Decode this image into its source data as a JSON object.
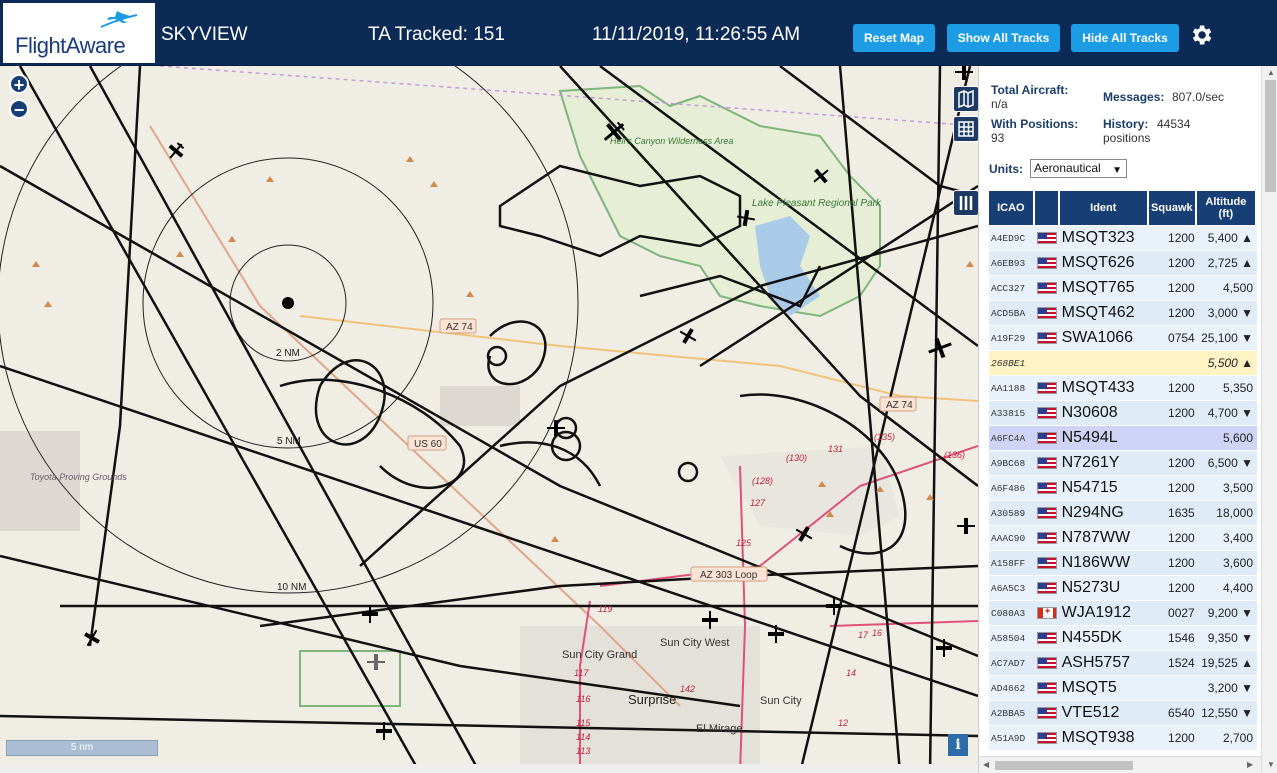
{
  "header": {
    "logo_text": "FlightAware",
    "app_title": "SKYVIEW",
    "tracked": "TA Tracked: 151",
    "datetime": "11/11/2019, 11:26:55 AM",
    "buttons": {
      "reset": "Reset Map",
      "show": "Show All Tracks",
      "hide": "Hide All Tracks"
    }
  },
  "map": {
    "zoom_in": "+",
    "zoom_out": "−",
    "scale": "5 nm",
    "info": "i",
    "range_labels": [
      "2 NM",
      "5 NM",
      "10 NM"
    ],
    "road_labels": [
      "AZ 74",
      "AZ 74",
      "US 60",
      "AZ 303 Loop"
    ],
    "places": [
      "Sun City Grand",
      "Sun City West",
      "Surprise",
      "Sun City",
      "El Mirage",
      "Lake Pleasant Regional Park",
      "Hell's Canyon Wilderness Area",
      "Toyota Proving Grounds"
    ],
    "route_numbers": [
      "(135)",
      "(130)",
      "131",
      "(136)",
      "(128)",
      "127",
      "125",
      "119",
      "117",
      "116",
      "115",
      "114",
      "113",
      "142",
      "17",
      "16",
      "14",
      "12"
    ]
  },
  "stats": {
    "total_aircraft_label": "Total Aircraft:",
    "total_aircraft_value": "n/a",
    "with_positions_label": "With Positions:",
    "with_positions_value": "93",
    "messages_label": "Messages:",
    "messages_value": "807.0/sec",
    "history_label": "History:",
    "history_value": "44534",
    "history_unit": "positions"
  },
  "units": {
    "label": "Units:",
    "value": "Aeronautical"
  },
  "table": {
    "headers": {
      "icao": "ICAO",
      "ident": "Ident",
      "squawk": "Squawk",
      "altitude": "Altitude",
      "altitude_unit": "(ft)"
    },
    "rows": [
      {
        "icao": "A4ED9C",
        "flag": "us",
        "ident": "MSQT323",
        "squawk": "1200",
        "alt": "5,400 ▲"
      },
      {
        "icao": "A6EB93",
        "flag": "us",
        "ident": "MSQT626",
        "squawk": "1200",
        "alt": "2,725 ▲"
      },
      {
        "icao": "ACC327",
        "flag": "us",
        "ident": "MSQT765",
        "squawk": "1200",
        "alt": "4,500"
      },
      {
        "icao": "ACD5BA",
        "flag": "us",
        "ident": "MSQT462",
        "squawk": "1200",
        "alt": "3,000 ▼"
      },
      {
        "icao": "A19F29",
        "flag": "us",
        "ident": "SWA1066",
        "squawk": "0754",
        "alt": "25,100 ▼"
      },
      {
        "icao": "268BE1",
        "flag": "",
        "ident": "",
        "squawk": "",
        "alt": "5,500 ▲",
        "state": "hl"
      },
      {
        "icao": "AA1188",
        "flag": "us",
        "ident": "MSQT433",
        "squawk": "1200",
        "alt": "5,350"
      },
      {
        "icao": "A33815",
        "flag": "us",
        "ident": "N30608",
        "squawk": "1200",
        "alt": "4,700 ▼"
      },
      {
        "icao": "A6FC4A",
        "flag": "us",
        "ident": "N5494L",
        "squawk": "",
        "alt": "5,600",
        "state": "sel"
      },
      {
        "icao": "A9BC68",
        "flag": "us",
        "ident": "N7261Y",
        "squawk": "1200",
        "alt": "6,500 ▼"
      },
      {
        "icao": "A6F486",
        "flag": "us",
        "ident": "N54715",
        "squawk": "1200",
        "alt": "3,500"
      },
      {
        "icao": "A30589",
        "flag": "us",
        "ident": "N294NG",
        "squawk": "1635",
        "alt": "18,000"
      },
      {
        "icao": "AAAC90",
        "flag": "us",
        "ident": "N787WW",
        "squawk": "1200",
        "alt": "3,400"
      },
      {
        "icao": "A158FF",
        "flag": "us",
        "ident": "N186WW",
        "squawk": "1200",
        "alt": "3,600"
      },
      {
        "icao": "A6A5C3",
        "flag": "us",
        "ident": "N5273U",
        "squawk": "1200",
        "alt": "4,400"
      },
      {
        "icao": "C080A3",
        "flag": "ca",
        "ident": "WJA1912",
        "squawk": "0027",
        "alt": "9,200 ▼"
      },
      {
        "icao": "A58504",
        "flag": "us",
        "ident": "N455DK",
        "squawk": "1546",
        "alt": "9,350 ▼"
      },
      {
        "icao": "AC7AD7",
        "flag": "us",
        "ident": "ASH5757",
        "squawk": "1524",
        "alt": "19,525 ▲"
      },
      {
        "icao": "AD4662",
        "flag": "us",
        "ident": "MSQT5",
        "squawk": "",
        "alt": "3,200 ▼"
      },
      {
        "icao": "A2BBA5",
        "flag": "us",
        "ident": "VTE512",
        "squawk": "6540",
        "alt": "12,550 ▼"
      },
      {
        "icao": "A51A9D",
        "flag": "us",
        "ident": "MSQT938",
        "squawk": "1200",
        "alt": "2,700"
      }
    ]
  },
  "colors": {
    "header_bg": "#0b2a56",
    "button": "#1d9ce6",
    "table_header": "#173e75",
    "highlight_row": "#fdf3c5",
    "selected_row": "#cfd3f5",
    "map_bg": "#f0ede5",
    "lake": "#aacbe8"
  }
}
